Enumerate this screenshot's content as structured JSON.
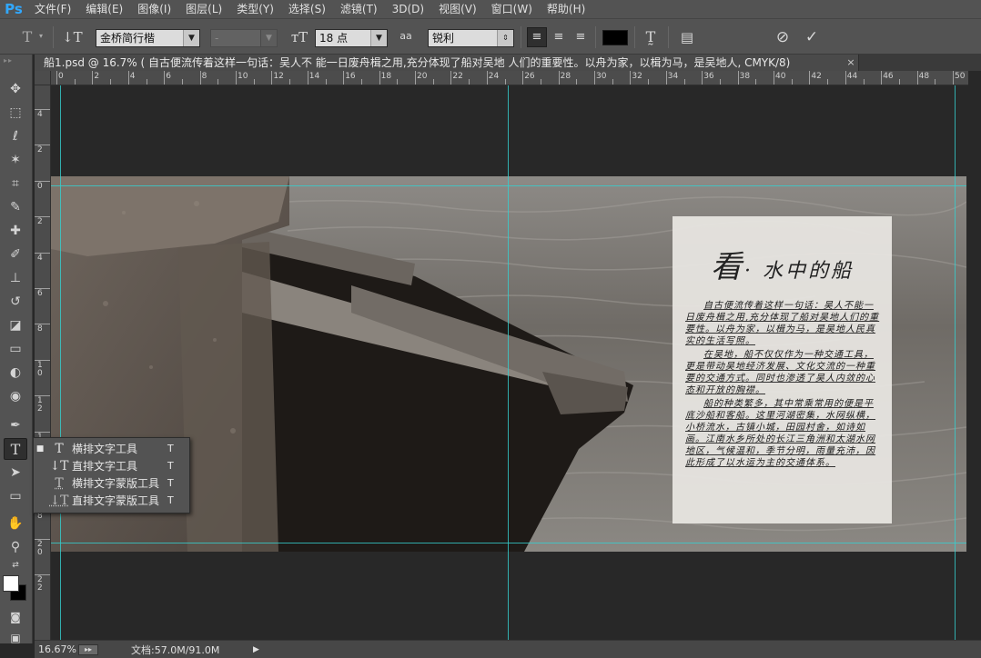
{
  "app": {
    "logo": "Ps"
  },
  "menu": [
    "文件(F)",
    "编辑(E)",
    "图像(I)",
    "图层(L)",
    "类型(Y)",
    "选择(S)",
    "滤镜(T)",
    "3D(D)",
    "视图(V)",
    "窗口(W)",
    "帮助(H)"
  ],
  "options": {
    "font_family": "金桥简行楷",
    "font_style": "-",
    "font_size": "18 点",
    "aa_label": "aa",
    "aa_method": "锐利",
    "text_color": "#000000"
  },
  "tab": {
    "title": "船1.psd @ 16.7% (      自古便流传着这样一句话：吴人不 能一日废舟楫之用,充分体现了船对吴地 人们的重要性。以舟为家，以楫为马，是吴地人, CMYK/8)",
    "close": "×"
  },
  "ruler_top": [
    "0",
    "2",
    "4",
    "6",
    "8",
    "10",
    "12",
    "14",
    "16",
    "18",
    "20",
    "22",
    "24",
    "26",
    "28",
    "30",
    "32",
    "34",
    "36",
    "38",
    "40",
    "42",
    "44",
    "46",
    "48",
    "50"
  ],
  "ruler_left": [
    "4",
    "2",
    "0",
    "2",
    "4",
    "6",
    "8",
    "1\n0",
    "1\n2",
    "1\n4",
    "1\n6",
    "1\n8",
    "2\n0",
    "2\n2"
  ],
  "document": {
    "title_big": "看",
    "title_rest": "· 水中的船",
    "paragraphs": [
      "自古便流传着这样一句话：吴人不能一日废舟楫之用,充分体现了船对吴地人们的重要性。以舟为家，以楫为马，是吴地人民真实的生活写照。",
      "在吴地，船不仅仅作为一种交通工具，更是带动吴地经济发展、文化交流的一种重要的交通方式。同时也渗透了吴人内敛的心态和开放的胸襟。",
      "船的种类繁多，其中常乘常用的便是平底沙船和客船。这里河湖密集，水网纵横，小桥流水，古镇小城，田园村舍，如诗如画。江南水乡所处的长江三角洲和太湖水网地区，气候温和，季节分明，雨量充沛，因此形成了以水运为主的交通体系。"
    ]
  },
  "flyout": [
    {
      "icon": "T",
      "label": "横排文字工具",
      "key": "T",
      "selected": true
    },
    {
      "icon": "↓T",
      "label": "直排文字工具",
      "key": "T",
      "selected": false
    },
    {
      "icon": "T",
      "label": "横排文字蒙版工具",
      "key": "T",
      "selected": false
    },
    {
      "icon": "↓T",
      "label": "直排文字蒙版工具",
      "key": "T",
      "selected": false
    }
  ],
  "status": {
    "zoom": "16.67%",
    "doc": "文档:57.0M/91.0M"
  },
  "colors": {
    "guide": "#35d0d0",
    "foreground": "#ffffff",
    "background": "#000000"
  }
}
